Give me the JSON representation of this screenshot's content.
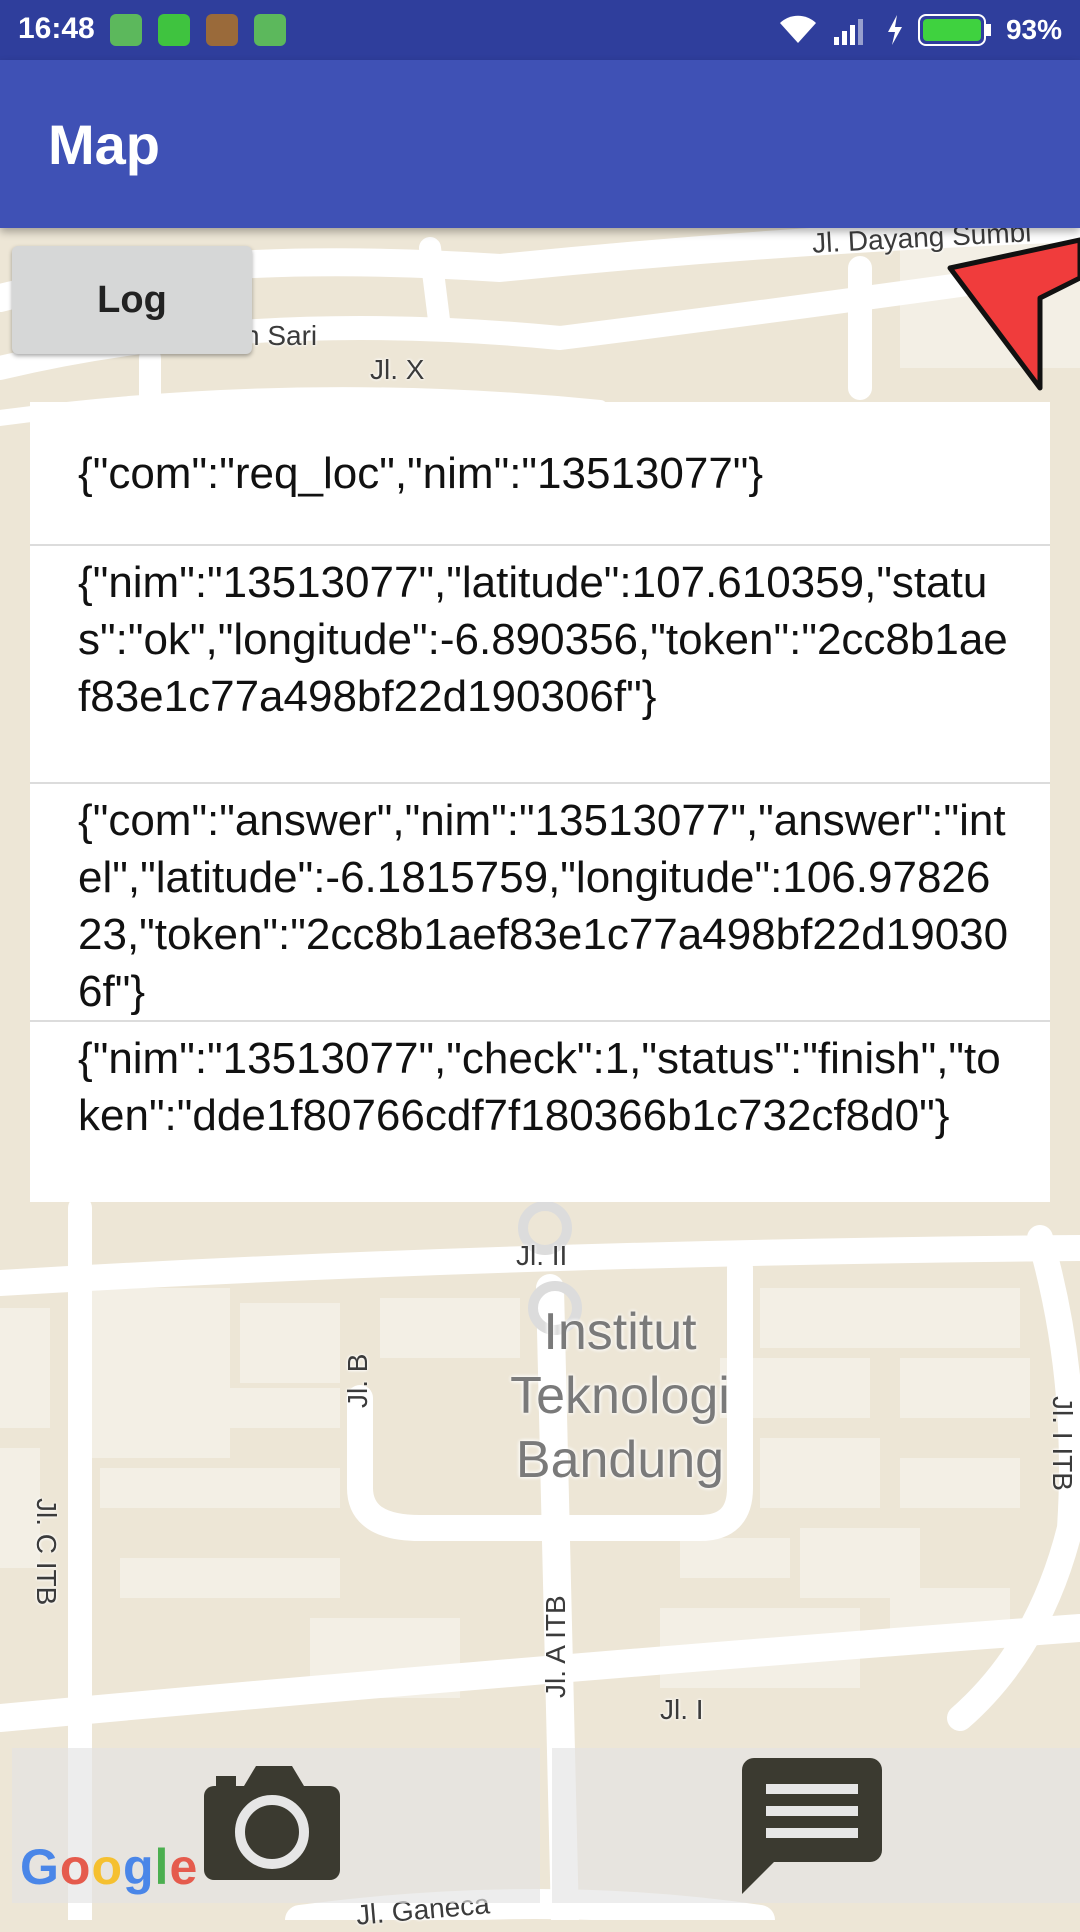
{
  "status_bar": {
    "time": "16:48",
    "battery": "93%",
    "notification_icons": [
      "android-icon",
      "line-icon",
      "android-icon",
      "android-icon"
    ]
  },
  "app_bar": {
    "title": "Map"
  },
  "log_button": {
    "label": "Log"
  },
  "log_entries": [
    "{\"com\":\"req_loc\",\"nim\":\"13513077\"}",
    "{\"nim\":\"13513077\",\"latitude\":107.610359,\"status\":\"ok\",\"longitude\":-6.890356,\"token\":\"2cc8b1aef83e1c77a498bf22d190306f\"}",
    "{\"com\":\"answer\",\"nim\":\"13513077\",\"answer\":\"intel\",\"latitude\":-6.1815759,\"longitude\":106.9782623,\"token\":\"2cc8b1aef83e1c77a498bf22d190306f\"}",
    "{\"nim\":\"13513077\",\"check\":1,\"status\":\"finish\",\"token\":\"dde1f80766cdf7f180366b1c732cf8d0\"}"
  ],
  "map": {
    "labels": {
      "dayang_sumbi": "Jl. Dayang Sumbi",
      "sari": "n Sari",
      "jl_x": "Jl. X",
      "jl_ii": "Jl. II",
      "jl_b": "Jl. B",
      "jl_c_itb": "Jl. C ITB",
      "jl_a_itb": "Jl. A ITB",
      "jl_i": "Jl. I",
      "jl_i_itb": "Jl. I ITB",
      "ganeca": "Jl. Ganeca"
    },
    "campus_lines": [
      "Institut",
      "Teknologi",
      "Bandung"
    ],
    "logo": "Google",
    "compass_color": "#f03c3c"
  },
  "bottom_bar": {
    "camera_icon": "camera-icon",
    "message_icon": "message-icon"
  }
}
